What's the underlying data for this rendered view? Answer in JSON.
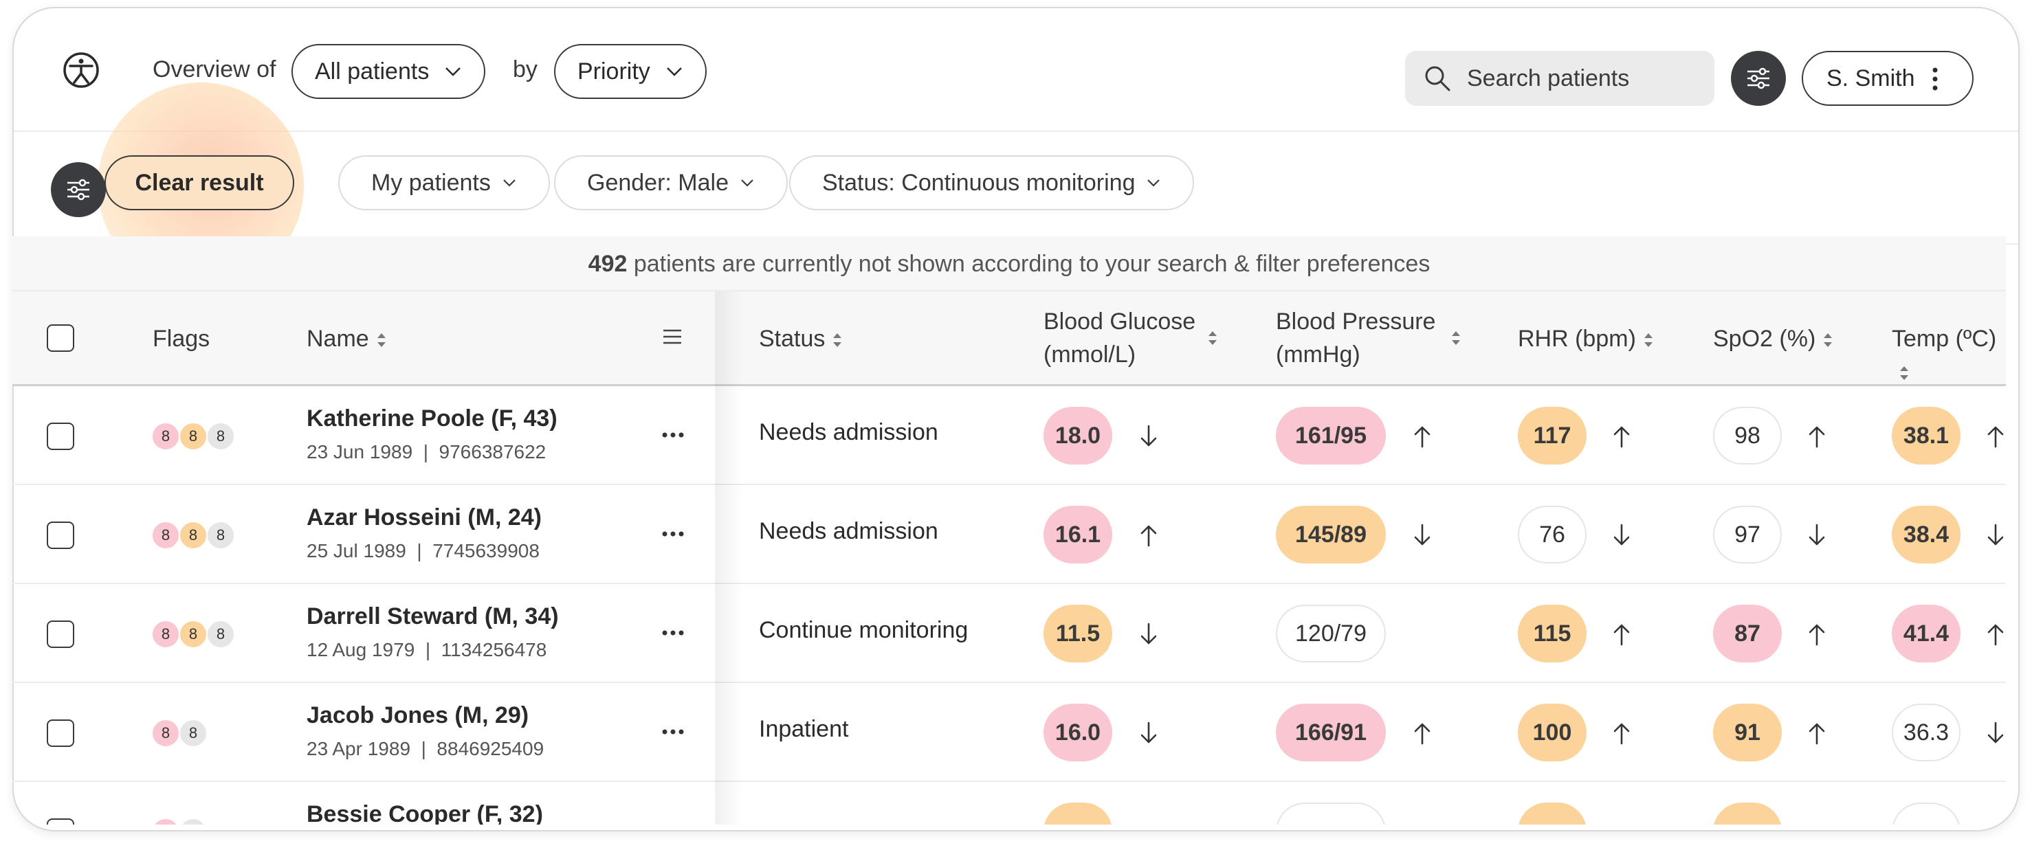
{
  "header": {
    "overview_label": "Overview of",
    "patients_select": "All patients",
    "by_label": "by",
    "sort_select": "Priority",
    "search_placeholder": "Search patients",
    "user_name": "S. Smith"
  },
  "filters": {
    "clear_label": "Clear result",
    "chips": [
      "My patients",
      "Gender: Male",
      "Status: Continuous monitoring"
    ]
  },
  "info": {
    "hidden_count": "492",
    "hidden_text": "patients are currently not shown according to your search & filter preferences"
  },
  "table": {
    "headers": {
      "flags": "Flags",
      "name": "Name",
      "status": "Status",
      "glucose_1": "Blood Glucose",
      "glucose_2": "(mmol/L)",
      "pressure_1": "Blood Pressure",
      "pressure_2": "(mmHg)",
      "rhr": "RHR (bpm)",
      "spo2": "SpO2 (%)",
      "temp": "Temp (ºC)"
    },
    "rows": [
      {
        "flags": [
          {
            "v": "8",
            "c": "pink"
          },
          {
            "v": "8",
            "c": "amber"
          },
          {
            "v": "8",
            "c": "grey"
          }
        ],
        "name": "Katherine Poole (F, 43)",
        "dob": "23 Jun 1989",
        "id": "9766387622",
        "status": "Needs admission",
        "glucose": {
          "v": "18.0",
          "c": "pink",
          "trend": "down"
        },
        "pressure": {
          "v": "161/95",
          "c": "pink",
          "trend": "up"
        },
        "rhr": {
          "v": "117",
          "c": "amber",
          "trend": "up"
        },
        "spo2": {
          "v": "98",
          "c": "plain",
          "trend": "up"
        },
        "temp": {
          "v": "38.1",
          "c": "amber",
          "trend": "up"
        }
      },
      {
        "flags": [
          {
            "v": "8",
            "c": "pink"
          },
          {
            "v": "8",
            "c": "amber"
          },
          {
            "v": "8",
            "c": "grey"
          }
        ],
        "name": "Azar Hosseini (M, 24)",
        "dob": "25 Jul 1989",
        "id": "7745639908",
        "status": "Needs admission",
        "glucose": {
          "v": "16.1",
          "c": "pink",
          "trend": "up"
        },
        "pressure": {
          "v": "145/89",
          "c": "amber",
          "trend": "down"
        },
        "rhr": {
          "v": "76",
          "c": "plain",
          "trend": "down"
        },
        "spo2": {
          "v": "97",
          "c": "plain",
          "trend": "down"
        },
        "temp": {
          "v": "38.4",
          "c": "amber",
          "trend": "down"
        }
      },
      {
        "flags": [
          {
            "v": "8",
            "c": "pink"
          },
          {
            "v": "8",
            "c": "amber"
          },
          {
            "v": "8",
            "c": "grey"
          }
        ],
        "name": "Darrell Steward (M, 34)",
        "dob": "12 Aug 1979",
        "id": "1134256478",
        "status": "Continue monitoring",
        "glucose": {
          "v": "11.5",
          "c": "amber",
          "trend": "down"
        },
        "pressure": {
          "v": "120/79",
          "c": "plain",
          "trend": ""
        },
        "rhr": {
          "v": "115",
          "c": "amber",
          "trend": "up"
        },
        "spo2": {
          "v": "87",
          "c": "pink",
          "trend": "up"
        },
        "temp": {
          "v": "41.4",
          "c": "pink",
          "trend": "up"
        }
      },
      {
        "flags": [
          {
            "v": "8",
            "c": "pink"
          },
          {
            "v": "8",
            "c": "grey"
          }
        ],
        "name": "Jacob Jones (M, 29)",
        "dob": "23 Apr 1989",
        "id": "8846925409",
        "status": "Inpatient",
        "glucose": {
          "v": "16.0",
          "c": "pink",
          "trend": "down"
        },
        "pressure": {
          "v": "166/91",
          "c": "pink",
          "trend": "up"
        },
        "rhr": {
          "v": "100",
          "c": "amber",
          "trend": "up"
        },
        "spo2": {
          "v": "91",
          "c": "amber",
          "trend": "up"
        },
        "temp": {
          "v": "36.3",
          "c": "plain",
          "trend": "down"
        }
      },
      {
        "flags": [
          {
            "v": "8",
            "c": "pink"
          },
          {
            "v": "8",
            "c": "grey"
          }
        ],
        "name": "Bessie Cooper (F, 32)",
        "dob": "",
        "id": "",
        "status": "",
        "glucose": {
          "v": "",
          "c": "amber",
          "trend": ""
        },
        "pressure": {
          "v": "",
          "c": "plain",
          "trend": ""
        },
        "rhr": {
          "v": "",
          "c": "amber",
          "trend": ""
        },
        "spo2": {
          "v": "",
          "c": "amber",
          "trend": ""
        },
        "temp": {
          "v": "",
          "c": "plain",
          "trend": ""
        }
      }
    ]
  },
  "colors": {
    "pink": "#f9c6d1",
    "amber": "#fcd39a",
    "dark": "#3b3c3f"
  },
  "icons": [
    "accessibility-logo-icon",
    "chevron-down-icon",
    "search-icon",
    "sliders-icon",
    "kebab-icon",
    "sort-icon",
    "list-icon",
    "more-horizontal-icon",
    "arrow-up-icon",
    "arrow-down-icon"
  ]
}
